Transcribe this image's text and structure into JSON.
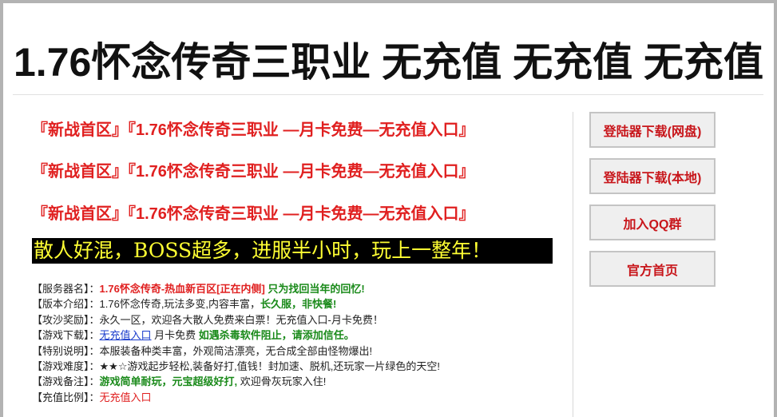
{
  "header": {
    "title": "1.76怀念传奇三职业 无充值 无充值 无充值"
  },
  "promo_lines": [
    "『新战首区』『1.76怀念传奇三职业 —月卡免费—无充值入口』",
    "『新战首区』『1.76怀念传奇三职业 —月卡免费—无充值入口』",
    "『新战首区』『1.76怀念传奇三职业 —月卡免费—无充值入口』"
  ],
  "banner": "散人好混，BOSS超多，进服半小时，玩上一整年！",
  "info": {
    "server_name": {
      "label": "【服务器名】：",
      "red": "1.76怀念传奇-热血新百区[正在内侧]",
      "green": " 只为找回当年的回忆!"
    },
    "version": {
      "label": "【版本介绍】：",
      "plain": "1.76怀念传奇,玩法多变,内容丰富，",
      "green": "长久服，非快餐!"
    },
    "rewards": {
      "label": "【攻沙奖励】：",
      "plain": "永久一区，欢迎各大散人免费来白票！无充值入口-月卡免费！"
    },
    "download": {
      "label": "【游戏下载】：",
      "link": "无充值入口",
      "plain": " 月卡免费 ",
      "green": "如遇杀毒软件阻止，请添加信任。"
    },
    "special": {
      "label": "【特别说明】：",
      "plain": "本服装备种类丰富，外观简洁漂亮，无合成全部由怪物爆出!"
    },
    "difficulty": {
      "label": "【游戏难度】：",
      "plain": "★★☆游戏起步轻松,装备好打,值钱！封加速、脱机,还玩家一片绿色的天空!"
    },
    "notes": {
      "label": "【游戏备注】：",
      "green": "游戏简单耐玩，元宝超级好打,",
      "plain": " 欢迎骨灰玩家入住!"
    },
    "ratio": {
      "label": "【充值比例】：",
      "red": "无充值入口"
    }
  },
  "sidebar": {
    "buttons": [
      "登陆器下载(网盘)",
      "登陆器下载(本地)",
      "加入QQ群",
      "官方首页"
    ]
  },
  "colors": {
    "accent_red": "#e02020",
    "green": "#1a8a1a",
    "link": "#1a3ccc",
    "banner_text": "#ffff33"
  }
}
